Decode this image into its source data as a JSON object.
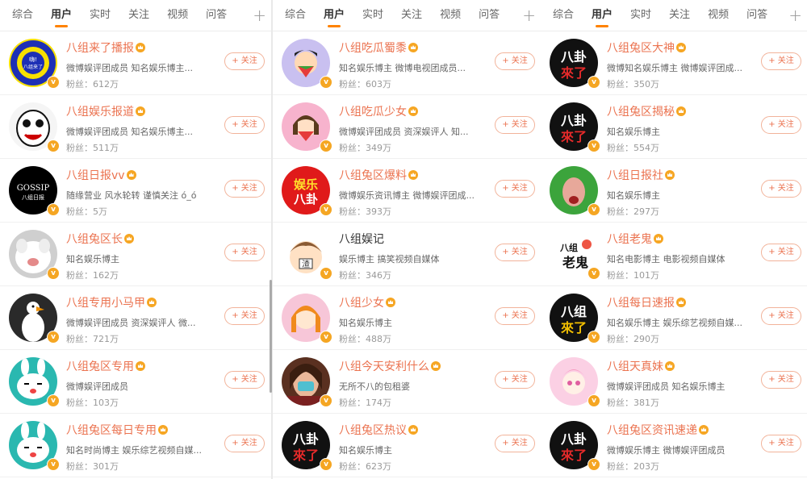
{
  "panels": [
    {
      "tabs": [
        "综合",
        "用户",
        "实时",
        "关注",
        "视频",
        "问答"
      ],
      "active_tab": 1,
      "users": [
        {
          "name": "八组来了播报",
          "desc": "微博娱评团成员 知名娱乐博主...",
          "fans": "粉丝：612万",
          "follow": "+ 关注",
          "crown": true,
          "avatar": "ring-yellow-blue"
        },
        {
          "name": "八组娱乐报道",
          "desc": "微博娱评团成员 知名娱乐博主...",
          "fans": "粉丝：511万",
          "follow": "+ 关注",
          "crown": true,
          "avatar": "cartoon-face"
        },
        {
          "name": "八组日报vv",
          "desc": "随缘营业 风水轮转 谨慎关注 ó_ó",
          "fans": "粉丝：5万",
          "follow": "+ 关注",
          "crown": true,
          "avatar": "gossip-black"
        },
        {
          "name": "八组兔区长",
          "desc": "知名娱乐博主",
          "fans": "粉丝：162万",
          "follow": "+ 关注",
          "crown": true,
          "avatar": "cat-photo"
        },
        {
          "name": "八组专用小马甲",
          "desc": "微博娱评团成员 资深娱评人 微...",
          "fans": "粉丝：721万",
          "follow": "+ 关注",
          "crown": true,
          "avatar": "goose-photo"
        },
        {
          "name": "八组兔区专用",
          "desc": "微博娱评团成员",
          "fans": "粉丝：103万",
          "follow": "+ 关注",
          "crown": true,
          "avatar": "bunny-teal"
        },
        {
          "name": "八组兔区每日专用",
          "desc": "知名时尚博主 娱乐综艺视频自媒...",
          "fans": "粉丝：301万",
          "follow": "+ 关注",
          "crown": true,
          "avatar": "bunny-teal"
        }
      ]
    },
    {
      "tabs": [
        "综合",
        "用户",
        "实时",
        "关注",
        "视频",
        "问答"
      ],
      "active_tab": 1,
      "users": [
        {
          "name": "八组吃瓜蜀黍",
          "desc": "知名娱乐博主 微博电视团成员...",
          "fans": "粉丝：603万",
          "follow": "+ 关注",
          "crown": true,
          "avatar": "melon-boy"
        },
        {
          "name": "八组吃瓜少女",
          "desc": "微博娱评团成员 资深娱评人 知...",
          "fans": "粉丝：349万",
          "follow": "+ 关注",
          "crown": true,
          "avatar": "melon-girl"
        },
        {
          "name": "八组兔区爆料",
          "desc": "微博娱乐资讯博主 微博娱评团成...",
          "fans": "粉丝：393万",
          "follow": "+ 关注",
          "crown": true,
          "avatar": "red-yule-bagua"
        },
        {
          "name": "八组娱记",
          "desc": "娱乐博主 搞笑视频自媒体",
          "fans": "粉丝：346万",
          "follow": "+ 关注",
          "crown": false,
          "avatar": "cartoon-head-zha"
        },
        {
          "name": "八组少女",
          "desc": "知名娱乐博主",
          "fans": "粉丝：488万",
          "follow": "+ 关注",
          "crown": true,
          "avatar": "orange-hair-girl"
        },
        {
          "name": "八组今天安利什么",
          "desc": "无所不八的包租婆",
          "fans": "粉丝：174万",
          "follow": "+ 关注",
          "crown": true,
          "avatar": "lady-photo"
        },
        {
          "name": "八组兔区热议",
          "desc": "知名娱乐博主",
          "fans": "粉丝：623万",
          "follow": "+ 关注",
          "crown": true,
          "avatar": "bagua-lailiao"
        }
      ]
    },
    {
      "tabs": [
        "综合",
        "用户",
        "实时",
        "关注",
        "视频",
        "问答"
      ],
      "active_tab": 1,
      "users": [
        {
          "name": "八组兔区大神",
          "desc": "微博知名娱乐博主 微博娱评团成...",
          "fans": "粉丝：350万",
          "follow": "+ 关注",
          "crown": true,
          "avatar": "bagua-lailiao"
        },
        {
          "name": "八组兔区揭秘",
          "desc": "知名娱乐博主",
          "fans": "粉丝：554万",
          "follow": "+ 关注",
          "crown": true,
          "avatar": "bagua-lailiao"
        },
        {
          "name": "八组日报社",
          "desc": "知名娱乐博主",
          "fans": "粉丝：297万",
          "follow": "+ 关注",
          "crown": true,
          "avatar": "green-man-photo"
        },
        {
          "name": "八组老鬼",
          "desc": "知名电影博主 电影视频自媒体",
          "fans": "粉丝：101万",
          "follow": "+ 关注",
          "crown": true,
          "avatar": "bazu-laogui"
        },
        {
          "name": "八组每日速报",
          "desc": "知名娱乐博主 娱乐综艺视频自媒...",
          "fans": "粉丝：290万",
          "follow": "+ 关注",
          "crown": true,
          "avatar": "bazu-lailiao"
        },
        {
          "name": "八组天真妹",
          "desc": "微博娱评团成员 知名娱乐博主",
          "fans": "粉丝：381万",
          "follow": "+ 关注",
          "crown": true,
          "avatar": "pink-anime"
        },
        {
          "name": "八组兔区资讯速递",
          "desc": "微博娱乐博主 微博娱评团成员",
          "fans": "粉丝：203万",
          "follow": "+ 关注",
          "crown": true,
          "avatar": "bagua-lailiao"
        }
      ]
    }
  ],
  "avatar_texts": {
    "ring": "嗨!八组来了",
    "gossip": "GOSSIP",
    "gossip_sub": "八组日报",
    "yule": "娱乐",
    "bagua": "八卦",
    "zha": "渣",
    "bagua_big": "八卦",
    "lailiao": "來了",
    "bazu": "八组",
    "laogui": "老鬼"
  },
  "colors": {
    "accent": "#ff8200",
    "name": "#eb7350",
    "badge": "#f5a623"
  },
  "plus_icon": "+"
}
